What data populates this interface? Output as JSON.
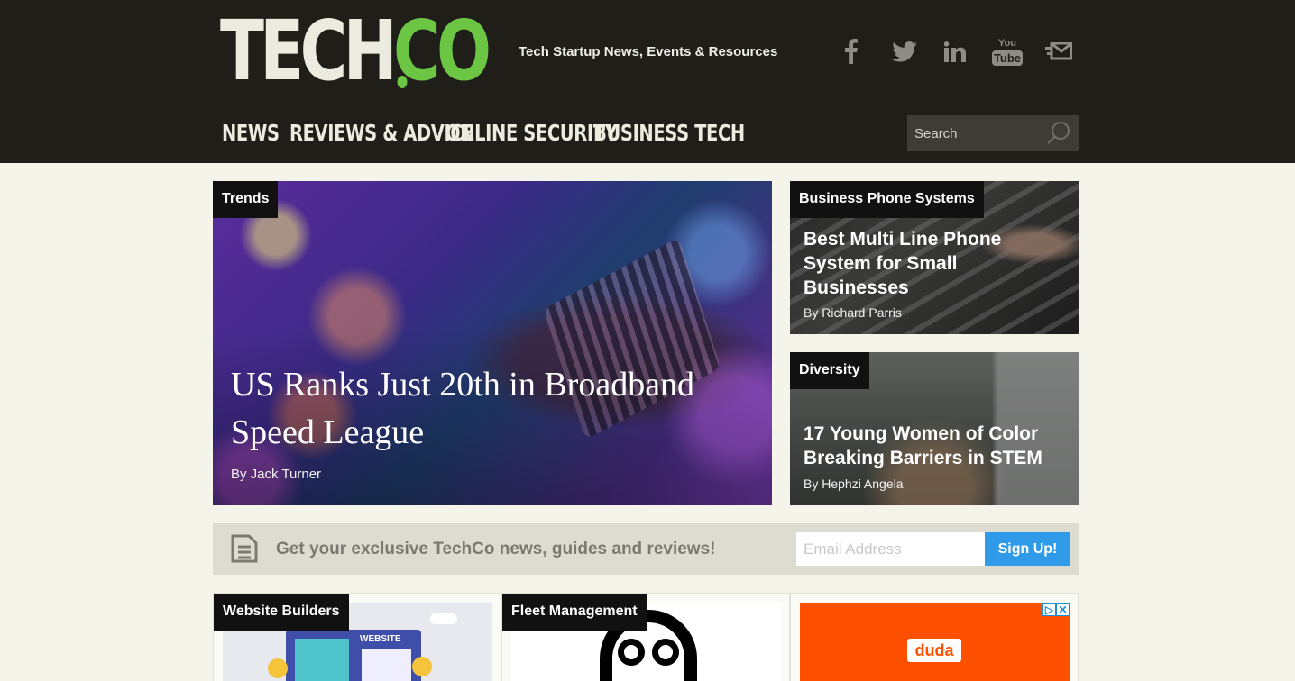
{
  "header": {
    "logo_tech": "TECH",
    "logo_co": "CO",
    "tagline": "Tech Startup News, Events & Resources",
    "social": [
      "facebook-icon",
      "twitter-icon",
      "linkedin-icon",
      "youtube-icon",
      "newsletter-mail-icon"
    ],
    "youtube_top": "You",
    "youtube_bottom": "Tube"
  },
  "nav": {
    "items": [
      "News",
      "Reviews & Advice",
      "Online Security",
      "Business Tech"
    ]
  },
  "search": {
    "placeholder": "Search"
  },
  "featured": {
    "hero": {
      "tag": "Trends",
      "title": "US Ranks Just 20th in Broadband Speed League",
      "byline": "By Jack Turner"
    },
    "side1": {
      "tag": "Business Phone Systems",
      "title": "Best Multi Line Phone System for Small Businesses",
      "byline": "By Richard Parris"
    },
    "side2": {
      "tag": "Diversity",
      "title": "17 Young Women of Color Breaking Barriers in STEM",
      "byline": "By Hephzi Angela"
    }
  },
  "newsletter": {
    "text": "Get your exclusive TechCo news, guides and reviews!",
    "email_placeholder": "Email Address",
    "button_label": "Sign Up!"
  },
  "bottom": {
    "col1_tag": "Website Builders",
    "col1_image_label": "WEBSITE",
    "col2_tag": "Fleet Management",
    "ad_logo": "duda",
    "ad_choice": "▷",
    "ad_close": "✕"
  },
  "colors": {
    "header_bg": "#1f1e19",
    "brand_green": "#6cc644",
    "page_bg": "#f4f4ea",
    "signup_blue": "#2f9be8",
    "ad_orange": "#ff5000"
  }
}
